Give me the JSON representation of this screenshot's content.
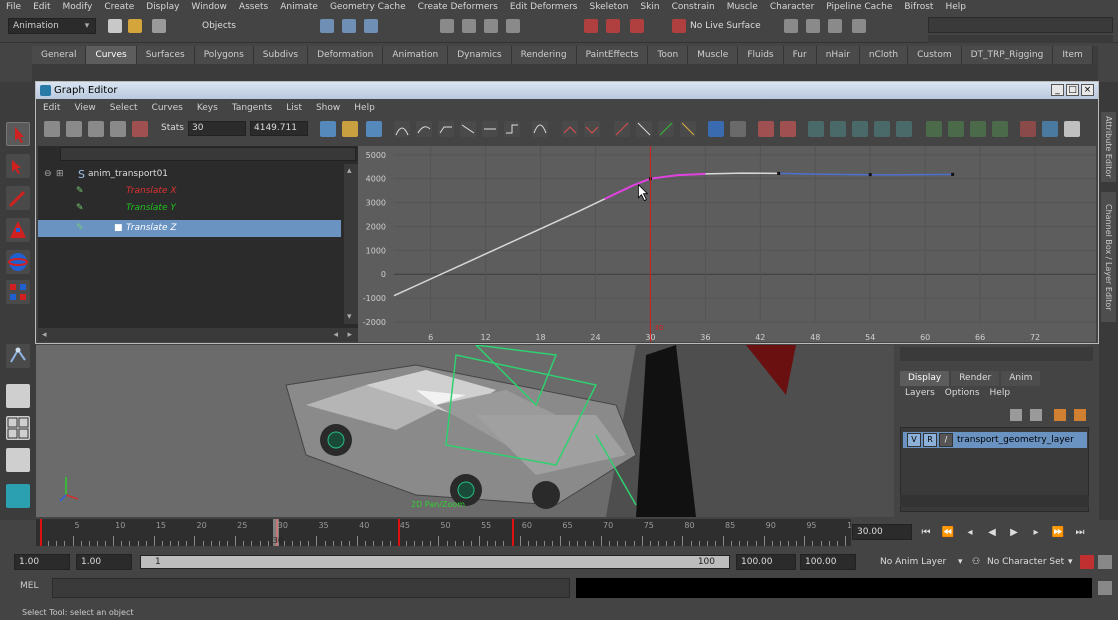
{
  "menubar": [
    "File",
    "Edit",
    "Modify",
    "Create",
    "Display",
    "Window",
    "Assets",
    "Animate",
    "Geometry Cache",
    "Create Deformers",
    "Edit Deformers",
    "Skeleton",
    "Skin",
    "Constrain",
    "Muscle",
    "Character",
    "Pipeline Cache",
    "Bifrost",
    "Help"
  ],
  "statusline": {
    "mode": "Animation",
    "object_selector": "Objects",
    "live_surface": "No Live Surface"
  },
  "shelf_tabs": [
    "General",
    "Curves",
    "Surfaces",
    "Polygons",
    "Subdivs",
    "Deformation",
    "Animation",
    "Dynamics",
    "Rendering",
    "PaintEffects",
    "Toon",
    "Muscle",
    "Fluids",
    "Fur",
    "nHair",
    "nCloth",
    "Custom",
    "DT_TRP_Rigging",
    "Item"
  ],
  "shelf_active": "Curves",
  "graph_editor": {
    "title": "Graph Editor",
    "menu": [
      "Edit",
      "View",
      "Select",
      "Curves",
      "Keys",
      "Tangents",
      "List",
      "Show",
      "Help"
    ],
    "stats_label": "Stats",
    "stats_frame": "30",
    "stats_value": "4149.711",
    "outliner": {
      "node": "anim_transport01",
      "channels": [
        {
          "label": "Translate X",
          "color": "#e03030"
        },
        {
          "label": "Translate Y",
          "color": "#20c020"
        },
        {
          "label": "Translate Z",
          "color": "#ffffff",
          "selected": true
        }
      ]
    },
    "y_ticks": [
      "5000",
      "4000",
      "3000",
      "2000",
      "1000",
      "0",
      "-1000",
      "-2000"
    ],
    "x_ticks": [
      "6",
      "12",
      "18",
      "24",
      "30",
      "36",
      "42",
      "48",
      "54",
      "60",
      "66",
      "72"
    ],
    "current_frame_label": "30"
  },
  "chart_data": {
    "type": "line",
    "title": "",
    "xlabel": "",
    "ylabel": "",
    "xlim": [
      2,
      78
    ],
    "ylim": [
      -2000,
      5200
    ],
    "series": [
      {
        "name": "Translate Z",
        "points": [
          [
            2,
            -900
          ],
          [
            6,
            -200
          ],
          [
            10,
            500
          ],
          [
            14,
            1200
          ],
          [
            18,
            1900
          ],
          [
            22,
            2600
          ],
          [
            25,
            3150
          ],
          [
            28,
            3700
          ],
          [
            30,
            4000
          ],
          [
            33,
            4150
          ],
          [
            36,
            4200
          ],
          [
            40,
            4230
          ],
          [
            44,
            4220
          ],
          [
            48,
            4190
          ],
          [
            52,
            4170
          ],
          [
            56,
            4160
          ],
          [
            60,
            4170
          ],
          [
            63,
            4180
          ]
        ],
        "keys": [
          [
            30,
            4000
          ],
          [
            44,
            4220
          ],
          [
            54,
            4170
          ],
          [
            63,
            4180
          ]
        ],
        "curve_color": "#d8d8d8",
        "selected_color": "#e040e0",
        "post_color": "#4f6fd0"
      }
    ],
    "current_time": 30,
    "grid": true
  },
  "viewport": {
    "hud_label": "2D Pan/Zoom"
  },
  "channel_strip": [
    "Attribute Editor",
    "Channel Box / Layer Editor"
  ],
  "layer_editor": {
    "tabs": [
      "Display",
      "Render",
      "Anim"
    ],
    "menu": [
      "Layers",
      "Options",
      "Help"
    ],
    "layer": {
      "v": "V",
      "r": "R",
      "name": "transport_geometry_layer"
    }
  },
  "timeslider": {
    "labels": [
      "5",
      "10",
      "15",
      "20",
      "25",
      "30",
      "35",
      "40",
      "45",
      "50",
      "55",
      "60",
      "65",
      "70",
      "75",
      "80",
      "85",
      "90",
      "95",
      "100"
    ],
    "key_frames": [
      1,
      30,
      45,
      59
    ],
    "current_frame": "30.00",
    "current_marker": "30"
  },
  "range": {
    "start": "1.00",
    "anim_start": "1.00",
    "slider_start": "1",
    "slider_end": "100",
    "anim_end": "100.00",
    "end": "100.00",
    "anim_layer": "No Anim Layer",
    "character_set": "No Character Set"
  },
  "command_line": {
    "label": "MEL"
  },
  "help_line": "Select Tool: select an object"
}
